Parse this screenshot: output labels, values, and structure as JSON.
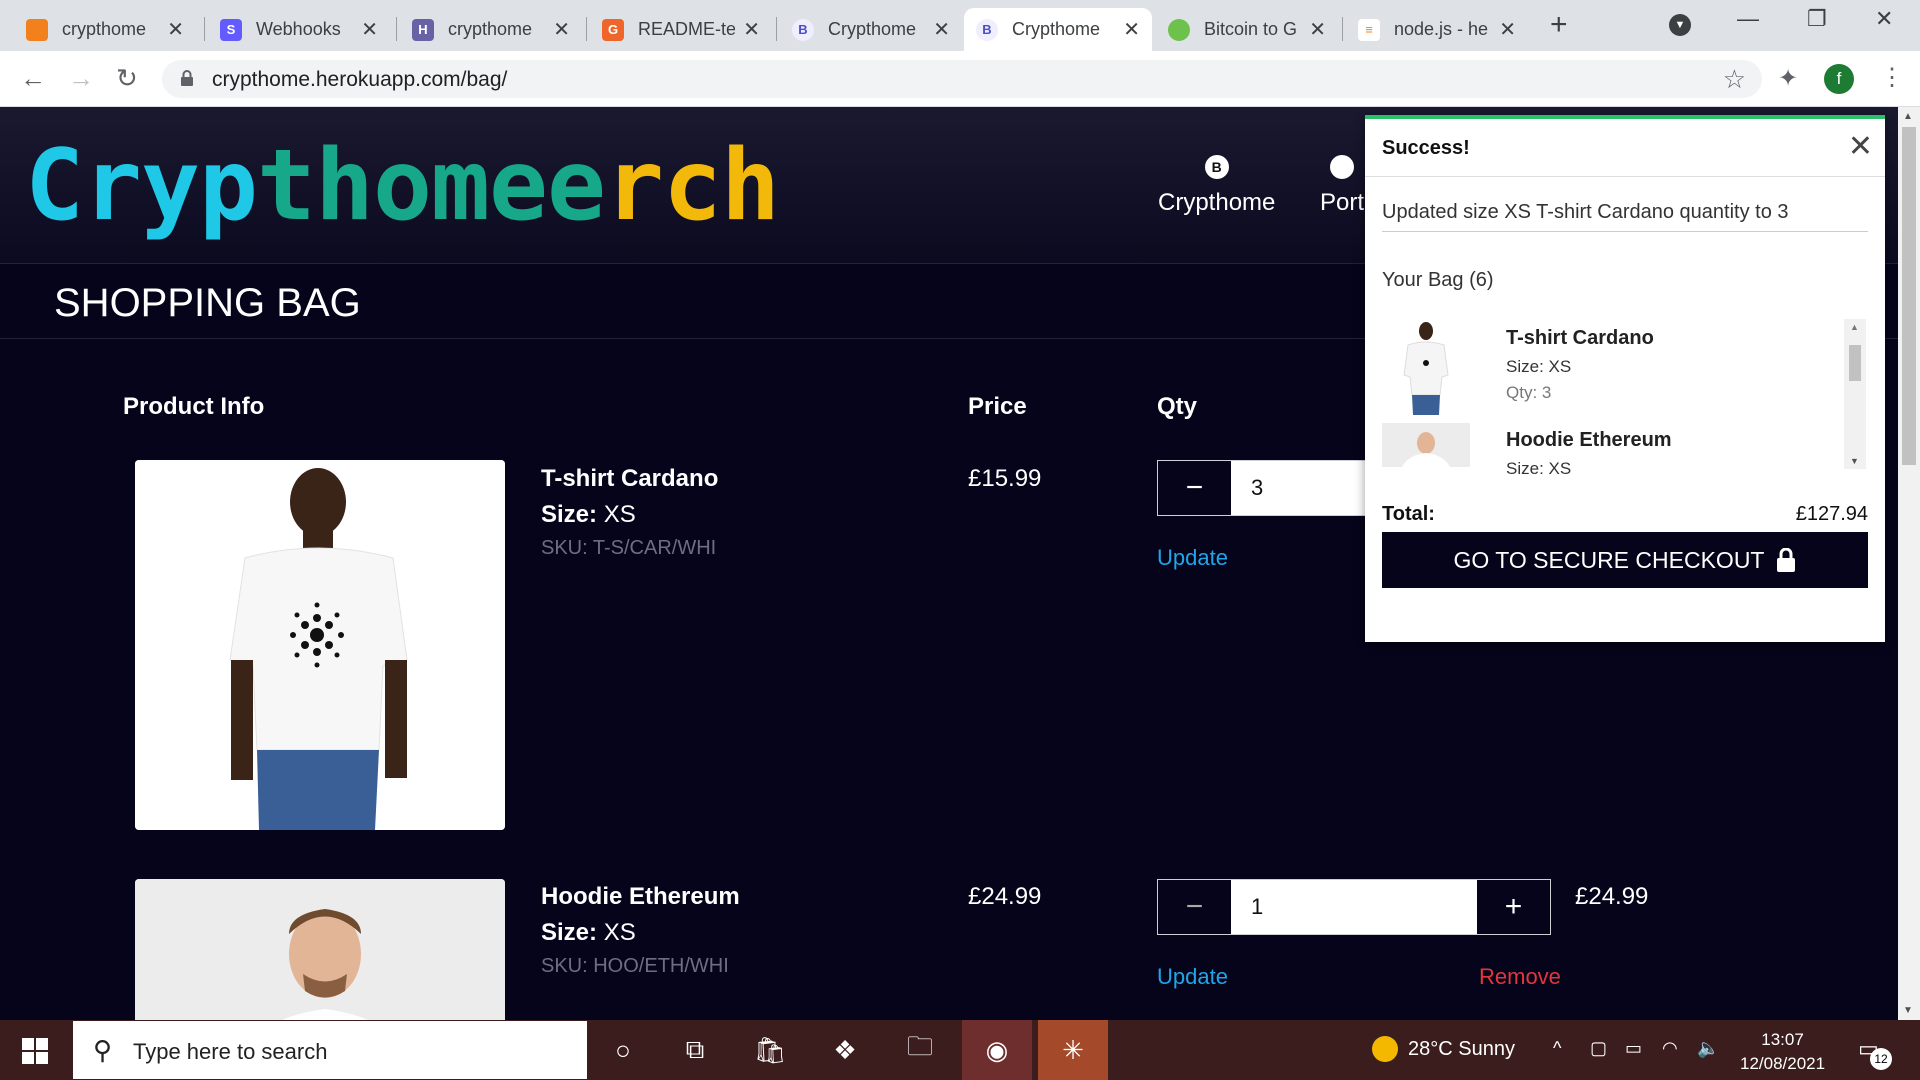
{
  "browser": {
    "tabs": [
      {
        "title": "crypthome",
        "color": "#f2811d"
      },
      {
        "title": "Webhooks",
        "color": "#635bff"
      },
      {
        "title": "crypthome",
        "color": "#6762a6"
      },
      {
        "title": "README-te",
        "color": "#f06529"
      },
      {
        "title": "Crypthome",
        "color": "#4b4fc4"
      },
      {
        "title": "Crypthome",
        "color": "#4b4fc4"
      },
      {
        "title": "Bitcoin to G",
        "color": "#6cc24a"
      },
      {
        "title": "node.js - he",
        "color": "#f48024"
      }
    ],
    "url": "crypthome.herokuapp.com/bag/",
    "avatar_letter": "f"
  },
  "site": {
    "logo": {
      "part1": "Cryp",
      "part2": "thome",
      "part3": "rch",
      "m": "me"
    },
    "nav": [
      {
        "label": "Crypthome",
        "coin": "B"
      },
      {
        "label": "Port",
        "coin": ""
      }
    ]
  },
  "bag": {
    "title": "SHOPPING BAG",
    "headers": {
      "product": "Product Info",
      "price": "Price",
      "qty": "Qty"
    },
    "items": [
      {
        "name": "T-shirt Cardano",
        "size_label": "Size:",
        "size": "XS",
        "sku": "SKU: T-S/CAR/WHI",
        "price": "£15.99",
        "qty": "3",
        "update": "Update"
      },
      {
        "name": "Hoodie Ethereum",
        "size_label": "Size:",
        "size": "XS",
        "sku": "SKU: HOO/ETH/WHI",
        "price": "£24.99",
        "qty": "1",
        "update": "Update",
        "remove": "Remove",
        "subtotal": "£24.99"
      }
    ]
  },
  "toast": {
    "title": "Success!",
    "message": "Updated size XS T-shirt Cardano quantity to 3",
    "your_bag": "Your Bag (6)",
    "items": [
      {
        "name": "T-shirt Cardano",
        "size": "Size: XS",
        "qty": "Qty: 3"
      },
      {
        "name": "Hoodie Ethereum",
        "size": "Size: XS"
      }
    ],
    "total_label": "Total:",
    "total_value": "£127.94",
    "checkout": "GO TO SECURE CHECKOUT"
  },
  "taskbar": {
    "search_placeholder": "Type here to search",
    "weather": "28°C  Sunny",
    "time": "13:07",
    "date": "12/08/2021",
    "notifications": "12"
  }
}
